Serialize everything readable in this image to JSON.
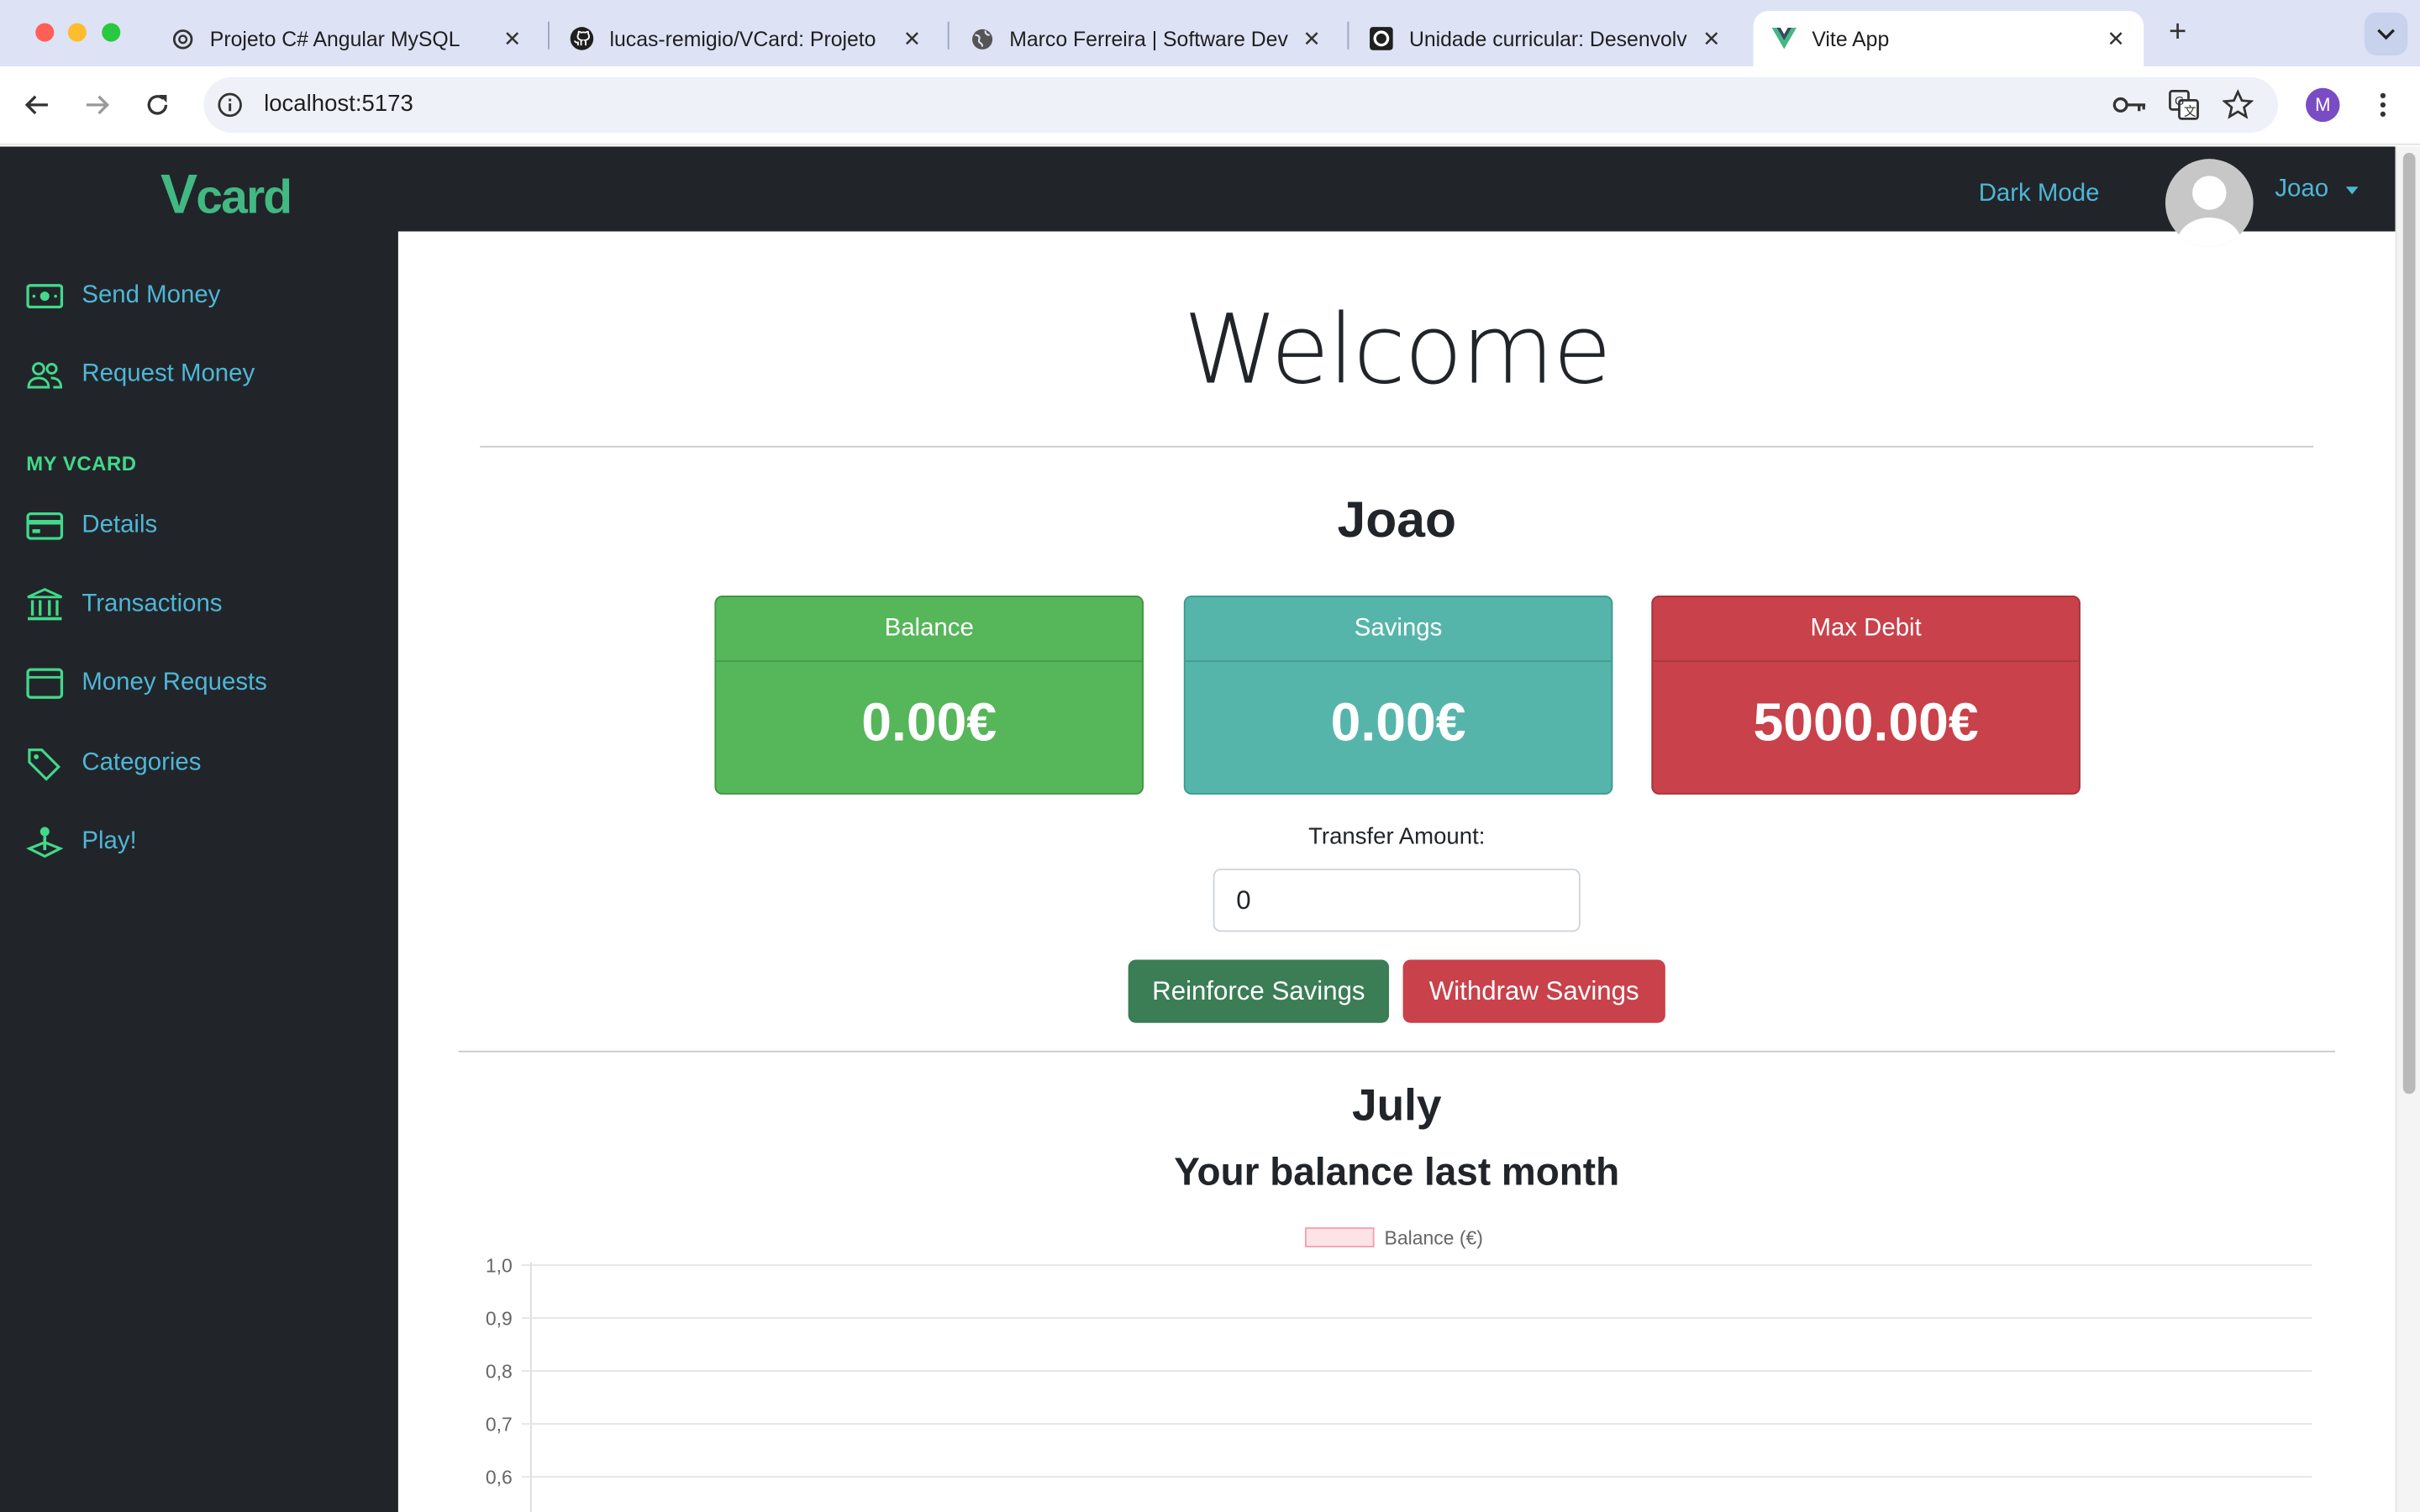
{
  "browser": {
    "tabs": [
      {
        "title": "Projeto C# Angular MySQL",
        "icon": "openai-icon"
      },
      {
        "title": "lucas-remigio/VCard: Projeto",
        "icon": "github-icon"
      },
      {
        "title": "Marco Ferreira | Software Dev",
        "icon": "globe-icon"
      },
      {
        "title": "Unidade curricular: Desenvolv",
        "icon": "moodle-icon"
      },
      {
        "title": "Vite App",
        "icon": "vue-icon"
      }
    ],
    "url": "localhost:5173",
    "profile_initial": "M"
  },
  "navbar": {
    "logo_first": "V",
    "logo_rest": "card",
    "dark_mode": "Dark Mode",
    "username": "Joao"
  },
  "sidebar": {
    "items": [
      {
        "label": "Send Money",
        "icon": "money-icon"
      },
      {
        "label": "Request Money",
        "icon": "people-icon"
      }
    ],
    "section_heading": "MY VCARD",
    "vcard_items": [
      {
        "label": "Details",
        "icon": "credit-card-icon"
      },
      {
        "label": "Transactions",
        "icon": "bank-icon"
      },
      {
        "label": "Money Requests",
        "icon": "wallet-icon"
      },
      {
        "label": "Categories",
        "icon": "tags-icon"
      },
      {
        "label": "Play!",
        "icon": "joystick-icon"
      }
    ]
  },
  "main": {
    "welcome": "Welcome",
    "name": "Joao",
    "cards": {
      "balance": {
        "label": "Balance",
        "value": "0.00€"
      },
      "savings": {
        "label": "Savings",
        "value": "0.00€"
      },
      "max_debit": {
        "label": "Max Debit",
        "value": "5000.00€"
      }
    },
    "transfer_label": "Transfer Amount:",
    "transfer_value": "0",
    "reinforce_button": "Reinforce Savings",
    "withdraw_button": "Withdraw Savings",
    "month": "July",
    "chart_title": "Your balance last month"
  },
  "colors": {
    "accent": "#4fb6d6",
    "brand": "#42b883",
    "balance_card": "#56b65a",
    "savings_card": "#56b5aa",
    "max_debit_card": "#c9414a"
  },
  "chart_data": {
    "type": "line",
    "title": "Your balance last month",
    "series": [
      {
        "name": "Balance (€)",
        "values": []
      }
    ],
    "y_ticks": [
      "1,0",
      "0,9",
      "0,8",
      "0,7",
      "0,6"
    ],
    "ylim": [
      0.6,
      1.0
    ],
    "legend": "top-center",
    "grid": true
  }
}
